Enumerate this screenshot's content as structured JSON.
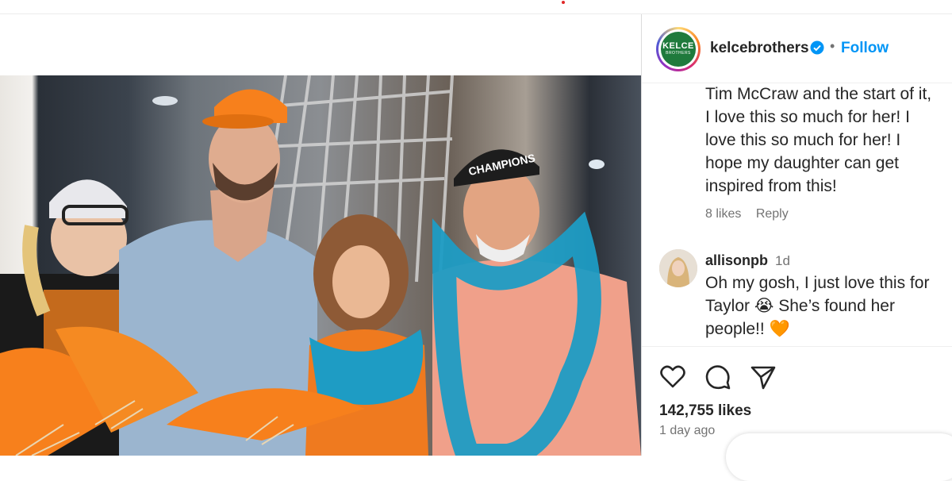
{
  "post": {
    "username": "kelcebrothers",
    "follow_label": "Follow",
    "avatar_text_top": "KELCE",
    "avatar_text_bottom": "BROTHERS",
    "separator": "•"
  },
  "comments": [
    {
      "lines": [
        "Tim McCraw and the start of it,",
        "I love this so much for her! I",
        "love this so much for her! I",
        "hope my daughter can get",
        "inspired from this!"
      ],
      "likes": "8 likes",
      "reply_label": "Reply"
    },
    {
      "user": "allisonpb",
      "time": "1d",
      "lines": [
        "Oh my gosh, I just love this for",
        "Taylor 😭 She’s found her",
        "people!! 🧡"
      ]
    }
  ],
  "stats": {
    "likes": "142,755 likes",
    "time_ago": "1 day ago"
  },
  "photo": {
    "cap_text": "CHAMPIONS"
  },
  "colors": {
    "accent_blue": "#0095f6",
    "orange": "#f7801c",
    "teal": "#1e9cc4",
    "text_gray": "#737373"
  },
  "icons": [
    "heart-icon",
    "comment-icon",
    "share-icon",
    "verified-badge-icon"
  ]
}
